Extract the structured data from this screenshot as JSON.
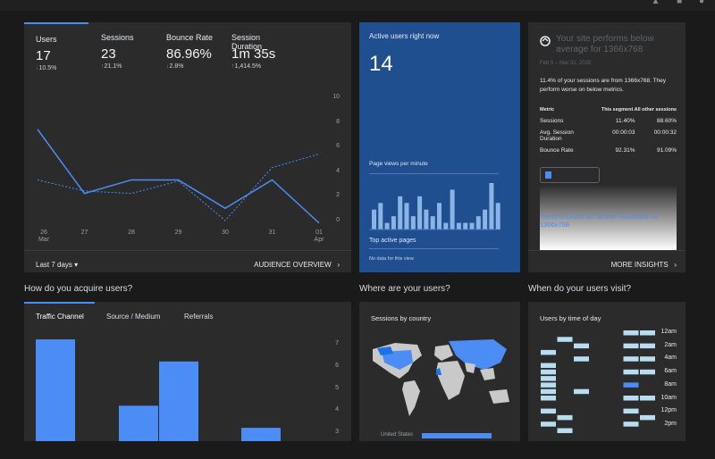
{
  "metrics": [
    {
      "label": "Users",
      "value": "17",
      "change": "10.5%",
      "dir": "down"
    },
    {
      "label": "Sessions",
      "value": "23",
      "change": "21.1%",
      "dir": "up"
    },
    {
      "label": "Bounce Rate",
      "value": "86.96%",
      "change": "2.8%",
      "dir": "down"
    },
    {
      "label": "Session Duration",
      "value": "1m 35s",
      "change": "1,414.5%",
      "dir": "up"
    }
  ],
  "line_chart": {
    "y_ticks": [
      "10",
      "8",
      "6",
      "4",
      "2",
      "0"
    ],
    "x_ticks": [
      [
        "26",
        "Mar"
      ],
      [
        "27",
        ""
      ],
      [
        "28",
        ""
      ],
      [
        "29",
        ""
      ],
      [
        "30",
        ""
      ],
      [
        "31",
        ""
      ],
      [
        "01",
        "Apr"
      ]
    ],
    "current": [
      7.4,
      2.2,
      3.3,
      3.3,
      1.0,
      3.3,
      -0.2
    ],
    "previous": [
      3.3,
      2.4,
      2.2,
      3.2,
      0.0,
      4.3,
      5.4
    ]
  },
  "overview_footer": {
    "range": "Last 7 days",
    "link": "AUDIENCE OVERVIEW"
  },
  "realtime": {
    "title": "Active users right now",
    "count": "14",
    "pv_title": "Page views per minute",
    "pv_values": [
      3,
      4,
      1,
      2,
      5,
      4,
      2,
      5,
      3,
      2,
      4,
      1,
      6,
      1,
      1,
      1,
      2,
      3,
      7,
      4
    ],
    "top_pages": "Top active pages",
    "no_data": "No data for this view"
  },
  "insights": {
    "headline": "Your site performs below average for 1366x768",
    "date": "Feb 5 – Mar 31, 2020",
    "body": "11.4% of your sessions are from 1366x768. They perform worse on below metrics.",
    "col_metric": "Metric",
    "col_segment": "This segment",
    "col_other": "All other sessions",
    "rows": [
      {
        "metric": "Sessions",
        "seg": "11.40%",
        "other": "88.60%"
      },
      {
        "metric": "Avg. Session Duration",
        "seg": "00:00:03",
        "other": "00:00:32"
      },
      {
        "metric": "Bounce Rate",
        "seg": "92.31%",
        "other": "91.09%"
      }
    ],
    "fade_text": "Trend of Users for Screen Resolution of 1366x768",
    "more": "MORE INSIGHTS"
  },
  "sections": {
    "acquire": "How do you acquire users?",
    "where": "Where are your users?",
    "when": "When do your users visit?"
  },
  "acquire": {
    "tabs": [
      "Traffic Channel",
      "Source / Medium",
      "Referrals"
    ],
    "y_ticks": [
      "7",
      "6",
      "5",
      "4",
      "3"
    ],
    "bars": [
      7.2,
      4.2,
      6.2,
      3.2
    ]
  },
  "geo": {
    "title": "Sessions by country",
    "country": "United States"
  },
  "time": {
    "title": "Users by time of day",
    "hours": [
      "12am",
      "2am",
      "4am",
      "6am",
      "8am",
      "10am",
      "12pm",
      "2pm"
    ]
  },
  "colors": {
    "accent": "#4b8cf5",
    "realtime_bg": "#1f4f8f"
  }
}
